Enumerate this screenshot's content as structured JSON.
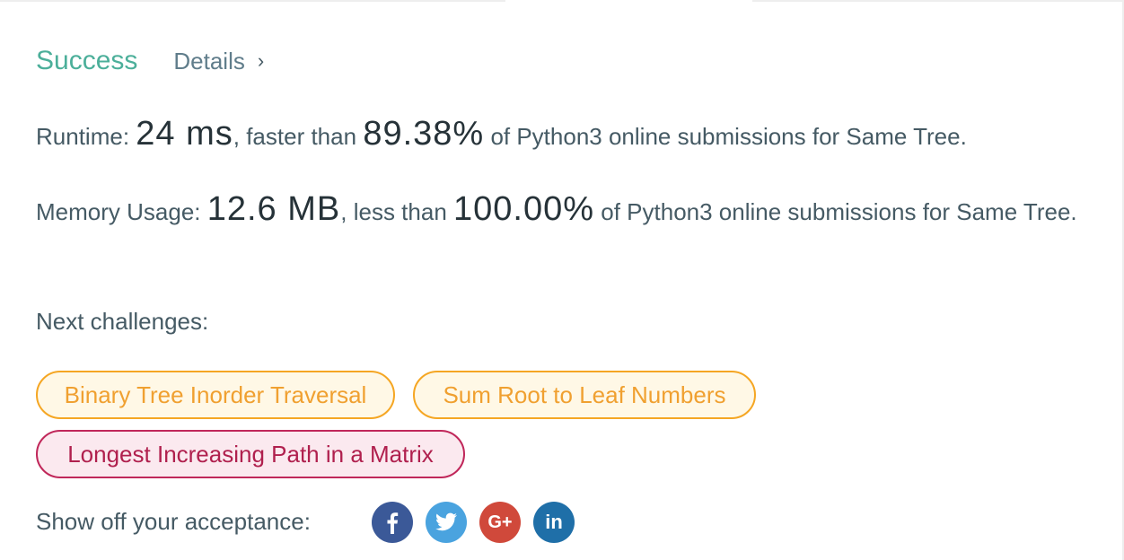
{
  "status": {
    "result": "Success",
    "details_label": "Details",
    "details_chevron": "›"
  },
  "runtime": {
    "label": "Runtime:",
    "value": "24 ms",
    "comparison": ", faster than",
    "percentile": "89.38%",
    "suffix": "of Python3 online submissions for Same Tree."
  },
  "memory": {
    "label": "Memory Usage:",
    "value": "12.6 MB",
    "comparison": ", less than",
    "percentile": "100.00%",
    "suffix": "of Python3 online submissions for Same Tree."
  },
  "next_challenges": {
    "label": "Next challenges:",
    "items": [
      {
        "title": "Binary Tree Inorder Traversal",
        "difficulty": "medium"
      },
      {
        "title": "Sum Root to Leaf Numbers",
        "difficulty": "medium"
      },
      {
        "title": "Longest Increasing Path in a Matrix",
        "difficulty": "hard"
      }
    ]
  },
  "share": {
    "label": "Show off your acceptance:",
    "buttons": [
      {
        "icon": "facebook-icon",
        "color": "#3b5998",
        "glyph": "f"
      },
      {
        "icon": "twitter-icon",
        "color": "#4aa3df",
        "glyph": "bird"
      },
      {
        "icon": "google-plus-icon",
        "color": "#d0493b",
        "glyph": "G+"
      },
      {
        "icon": "linkedin-icon",
        "color": "#1f6fa8",
        "glyph": "in"
      }
    ]
  },
  "colors": {
    "success": "#4caf9a",
    "medium_border": "#f5a623",
    "hard_border": "#c0275a"
  }
}
